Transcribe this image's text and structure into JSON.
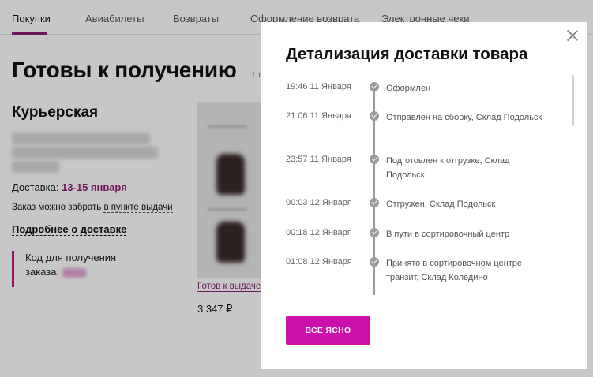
{
  "tabs": [
    {
      "label": "Покупки",
      "active": true
    },
    {
      "label": "Авиабилеты"
    },
    {
      "label": "Возвраты"
    },
    {
      "label": "Оформление возврата"
    },
    {
      "label": "Электронные чеки"
    }
  ],
  "page": {
    "title": "Готовы к получению",
    "count_fragment": "1 т"
  },
  "delivery": {
    "type": "Курьерская",
    "dates_label": "Доставка:",
    "dates": "13-15 января",
    "pickup_prefix": "Заказ можно забрать",
    "pickup_link": "в пункте выдачи",
    "more_link": "Подробнее о доставке",
    "code_label": "Код для получения",
    "code_label_2": "заказа:"
  },
  "product": {
    "status": "Готов к выдаче",
    "price": "3 347 ₽"
  },
  "modal": {
    "title": "Детализация доставки товара",
    "events": [
      {
        "time": "19:46 11 Января",
        "text": "Оформлен"
      },
      {
        "time": "21:06 11 Января",
        "text": "Отправлен на сборку, Склад Подольск"
      },
      {
        "time": "23:57 11 Января",
        "text": "Подготовлен к отгрузке, Склад Подольск"
      },
      {
        "time": "00:03 12 Января",
        "text": "Отгружен, Склад Подольск"
      },
      {
        "time": "00:18 12 Января",
        "text": "В пути в сортировочный центр"
      },
      {
        "time": "01:08 12 Января",
        "text": "Принято в сортировочном центре транзит, Склад Коледино"
      }
    ],
    "ok_label": "ВСЕ ЯСНО"
  },
  "colors": {
    "accent": "#cb11ab",
    "brand_text": "#8b1f7a"
  },
  "icons": [
    "close-icon",
    "check-icon",
    "jacket-image"
  ]
}
